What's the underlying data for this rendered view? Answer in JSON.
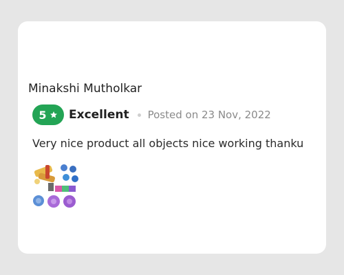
{
  "review": {
    "reviewer_name": "Minakshi Mutholkar",
    "rating": {
      "value": "5",
      "max": 5,
      "star_icon": "star-icon",
      "label": "Excellent",
      "badge_color": "#23a455"
    },
    "posted_date": "Posted on 23 Nov, 2022",
    "text": "Very nice product all objects nice working thanku",
    "media": [
      {
        "type": "photo",
        "icon": "product-photo-thumbnail"
      }
    ]
  }
}
